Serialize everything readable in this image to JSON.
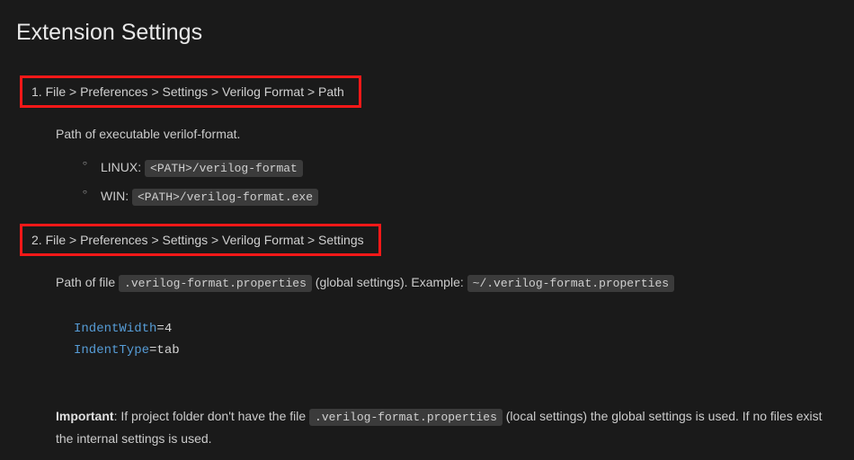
{
  "heading": "Extension Settings",
  "step1": {
    "breadcrumb": "1. File > Preferences > Settings > Verilog Format > Path",
    "description": "Path of executable verilof-format.",
    "linux_label": "LINUX: ",
    "linux_path": "<PATH>/verilog-format",
    "win_label": "WIN: ",
    "win_path": "<PATH>/verilog-format.exe"
  },
  "step2": {
    "breadcrumb": "2. File > Preferences > Settings > Verilog Format > Settings",
    "desc_prefix": "Path of file ",
    "desc_code1": ".verilog-format.properties",
    "desc_mid": " (global settings). Example: ",
    "desc_code2": "~/.verilog-format.properties"
  },
  "snippet": {
    "line1_key": "IndentWidth",
    "line1_rest": "=4",
    "line2_key": "IndentType",
    "line2_rest": "=tab"
  },
  "note": {
    "strong": "Important",
    "text_before": ": If project folder don't have the file ",
    "code": ".verilog-format.properties",
    "text_after": " (local settings) the global settings is used. If no files exist the internal settings is used."
  }
}
